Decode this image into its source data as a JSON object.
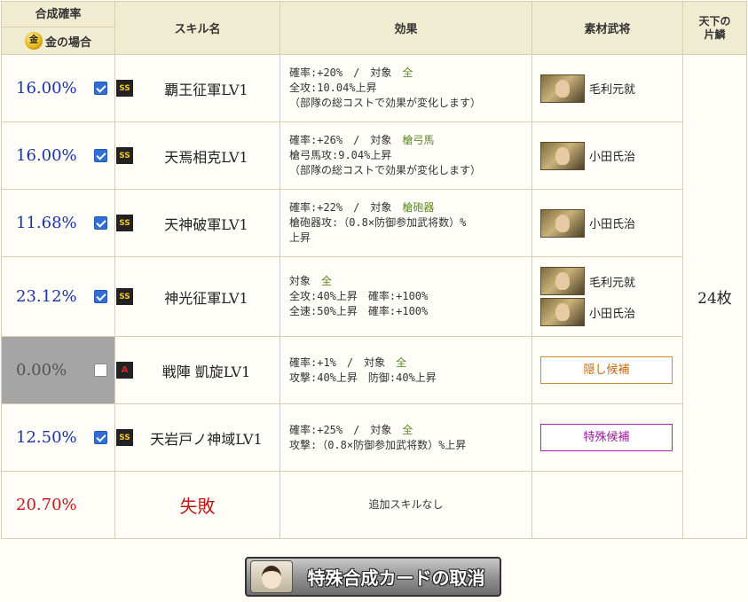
{
  "header": {
    "rate_title": "合成確率",
    "gold_icon": "金",
    "gold_label": "金の場合",
    "skill_name": "スキル名",
    "effect": "効果",
    "material": "素材武将",
    "tenka_line1": "天下の",
    "tenka_line2": "片鱗"
  },
  "rows": [
    {
      "rate": "16.00%",
      "checked": true,
      "rank": "SS",
      "skill": "覇王征軍LV1",
      "effect": {
        "l1_pre": "確率:+20%　/　対象　",
        "l1_target": "全",
        "l2": "全攻:10.04%上昇",
        "l3": "（部隊の総コストで効果が変化します）"
      },
      "materials": [
        {
          "name": "毛利元就"
        }
      ]
    },
    {
      "rate": "16.00%",
      "checked": true,
      "rank": "SS",
      "skill": "天焉相克LV1",
      "effect": {
        "l1_pre": "確率:+26%　/　対象　",
        "l1_target": "槍弓馬",
        "l2": "槍弓馬攻:9.04%上昇",
        "l3": "（部隊の総コストで効果が変化します）"
      },
      "materials": [
        {
          "name": "小田氏治"
        }
      ]
    },
    {
      "rate": "11.68%",
      "checked": true,
      "rank": "SS",
      "skill": "天神破軍LV1",
      "effect": {
        "l1_pre": "確率:+22%　/　対象　",
        "l1_target": "槍砲器",
        "l2": "槍砲器攻:（0.8×防御参加武将数）%",
        "l3": "上昇"
      },
      "materials": [
        {
          "name": "小田氏治"
        }
      ]
    },
    {
      "rate": "23.12%",
      "checked": true,
      "rank": "SS",
      "skill": "神光征軍LV1",
      "effect": {
        "l1_pre": "対象　",
        "l1_target": "全",
        "l2": "全攻:40%上昇　確率:+100%",
        "l3": "全速:50%上昇　確率:+100%"
      },
      "materials": [
        {
          "name": "毛利元就"
        },
        {
          "name": "小田氏治"
        }
      ]
    },
    {
      "rate": "0.00%",
      "checked": false,
      "rank": "A",
      "skill": "戦陣 凱旋LV1",
      "effect": {
        "l1_pre": "確率:+1%　/　対象　",
        "l1_target": "全",
        "l2": "攻撃:40%上昇　防御:40%上昇",
        "l3": ""
      },
      "candidate": "隠し候補"
    },
    {
      "rate": "12.50%",
      "checked": true,
      "rank": "SS",
      "skill": "天岩戸ノ神域LV1",
      "effect": {
        "l1_pre": "確率:+25%　/　対象　",
        "l1_target": "全",
        "l2": "攻撃:（0.8×防御参加武将数）%上昇",
        "l3": ""
      },
      "candidate": "特殊候補"
    }
  ],
  "fail_row": {
    "rate": "20.70%",
    "label": "失敗",
    "effect": "追加スキルなし"
  },
  "tenka_count": "24枚",
  "cancel_button": "特殊合成カードの取消",
  "colors": {
    "rate_blue": "#1a33a8",
    "fail_red": "#c01818",
    "target_green": "#5b8a1e",
    "header_bg": "#f0ecd2"
  }
}
